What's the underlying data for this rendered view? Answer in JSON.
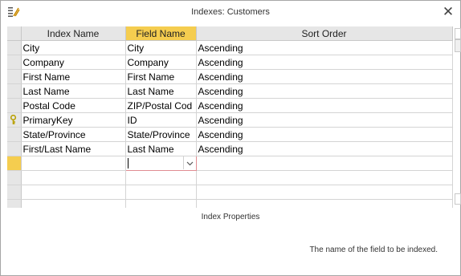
{
  "window": {
    "title": "Indexes: Customers",
    "close_label": "✕"
  },
  "columns": {
    "index_name": "Index Name",
    "field_name": "Field Name",
    "sort_order": "Sort Order"
  },
  "rows": [
    {
      "index_name": "City",
      "field_name": "City",
      "sort_order": "Ascending",
      "primary": false
    },
    {
      "index_name": "Company",
      "field_name": "Company",
      "sort_order": "Ascending",
      "primary": false
    },
    {
      "index_name": "First Name",
      "field_name": "First Name",
      "sort_order": "Ascending",
      "primary": false
    },
    {
      "index_name": "Last Name",
      "field_name": "Last Name",
      "sort_order": "Ascending",
      "primary": false
    },
    {
      "index_name": "Postal Code",
      "field_name": "ZIP/Postal Cod",
      "sort_order": "Ascending",
      "primary": false
    },
    {
      "index_name": "PrimaryKey",
      "field_name": "ID",
      "sort_order": "Ascending",
      "primary": true
    },
    {
      "index_name": "State/Province",
      "field_name": "State/Province",
      "sort_order": "Ascending",
      "primary": false
    },
    {
      "index_name": "First/Last Name",
      "field_name": "Last Name",
      "sort_order": "Ascending",
      "primary": false
    }
  ],
  "new_row": {
    "field_value": "",
    "dropdown_icon": "chevron-down-icon"
  },
  "properties": {
    "title": "Index Properties",
    "help_text": "The name of the field to be indexed."
  },
  "icons": {
    "title": "index-list-icon",
    "primary_key": "key-icon",
    "close": "close-icon"
  },
  "colors": {
    "active_header": "#f5cd4f",
    "active_cell_border": "#e08c92"
  }
}
